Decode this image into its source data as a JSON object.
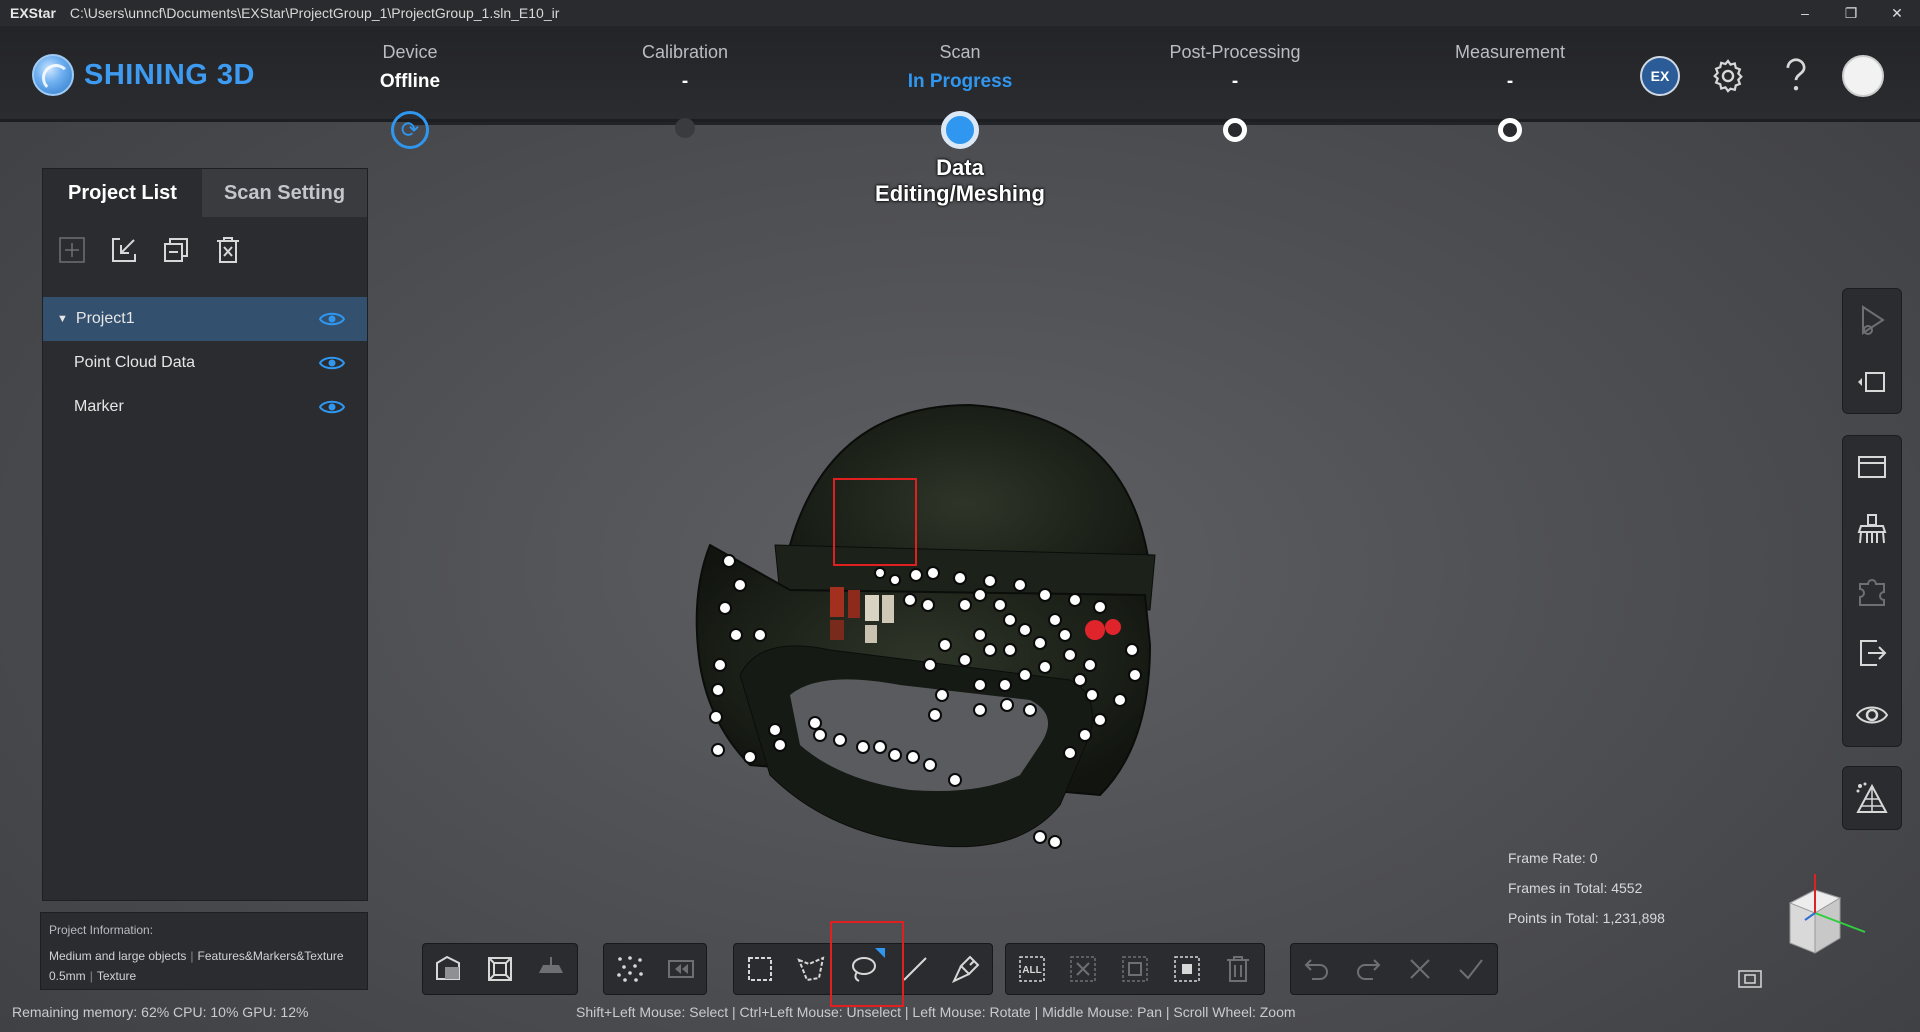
{
  "titlebar": {
    "app": "EXStar",
    "path": "C:\\Users\\unncf\\Documents\\EXStar\\ProjectGroup_1\\ProjectGroup_1.sln_E10_ir",
    "minimize": "–",
    "restore": "❐",
    "close": "✕"
  },
  "header": {
    "logo_text": "SHINING 3D",
    "steps": [
      {
        "label": "Device",
        "value": "Offline"
      },
      {
        "label": "Calibration",
        "value": "-"
      },
      {
        "label": "Scan",
        "value": "In Progress"
      },
      {
        "label": "Post-Processing",
        "value": "-"
      },
      {
        "label": "Measurement",
        "value": "-"
      }
    ],
    "sub_step": "Data Editing/Meshing",
    "ex_badge": "EX"
  },
  "panel": {
    "tabs": [
      "Project List",
      "Scan Setting"
    ],
    "tree": [
      {
        "label": "Project1"
      },
      {
        "label": "Point Cloud Data"
      },
      {
        "label": "Marker"
      }
    ]
  },
  "info": {
    "title": "Project Information:",
    "line1a": "Medium and large objects",
    "line1b": "Features&Markers&Texture",
    "line2a": "0.5mm",
    "line2b": "Texture"
  },
  "stats": {
    "frame_rate": "Frame Rate: 0",
    "frames_total": "Frames in Total: 4552",
    "points_total": "Points in Total: 1,231,898"
  },
  "status": "Remaining memory: 62% CPU: 10% GPU: 12%",
  "hint": "Shift+Left Mouse: Select | Ctrl+Left Mouse: Unselect | Left Mouse: Rotate | Middle Mouse: Pan | Scroll Wheel: Zoom",
  "toolbar": {
    "all_label": "ALL"
  },
  "colors": {
    "accent": "#2f97f0",
    "highlight": "#e02020",
    "panel": "#2b2c2f"
  }
}
